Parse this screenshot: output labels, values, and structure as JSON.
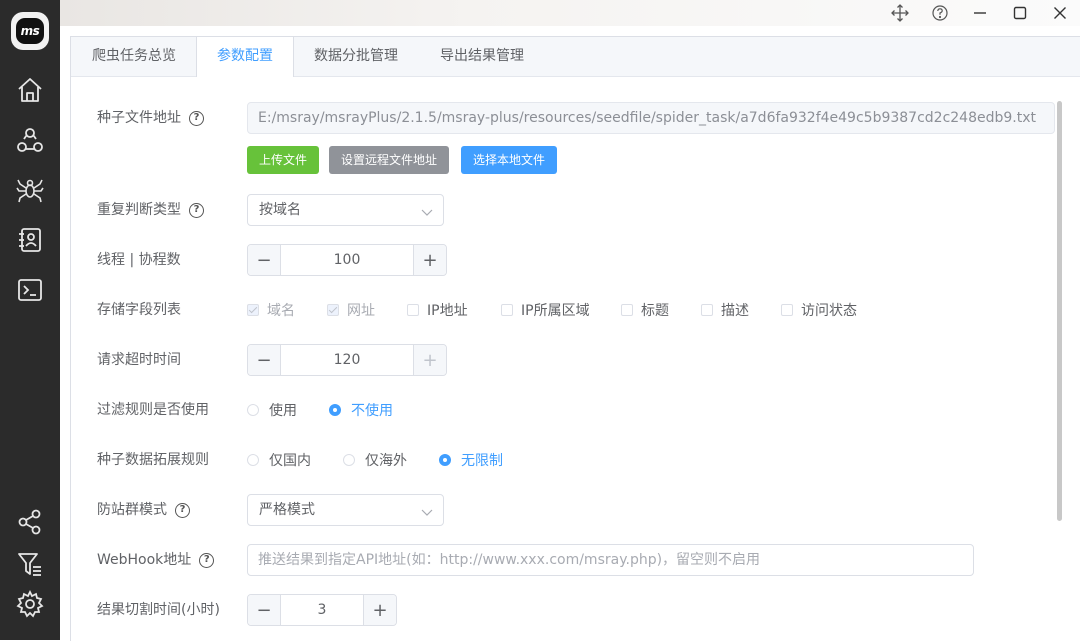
{
  "app": {
    "logo_text": "ms"
  },
  "colors": {
    "accent": "#409eff",
    "upload": "#67c23a",
    "remote": "#909399",
    "local": "#409eff"
  },
  "sidebar": {
    "items": [
      {
        "icon": "home-icon"
      },
      {
        "icon": "nodes-icon"
      },
      {
        "icon": "spider-icon"
      },
      {
        "icon": "contacts-icon"
      },
      {
        "icon": "terminal-icon"
      },
      {
        "icon": "share-icon"
      },
      {
        "icon": "filter-list-icon"
      },
      {
        "icon": "gear-icon"
      }
    ]
  },
  "window_controls": [
    "move-icon",
    "help-icon",
    "minimize-icon",
    "maximize-icon",
    "close-icon"
  ],
  "tabs": [
    {
      "label": "爬虫任务总览"
    },
    {
      "label": "参数配置"
    },
    {
      "label": "数据分批管理"
    },
    {
      "label": "导出结果管理"
    }
  ],
  "active_tab": "参数配置",
  "form": {
    "seed_file": {
      "label": "种子文件地址",
      "value": "E:/msray/msrayPlus/2.1.5/msray-plus/resources/seedfile/spider_task/a7d6fa932f4e49c5b9387cd2c248edb9.txt",
      "btn_upload": "上传文件",
      "btn_remote": "设置远程文件地址",
      "btn_local": "选择本地文件"
    },
    "dup_type": {
      "label": "重复判断类型",
      "value": "按域名"
    },
    "threads": {
      "label": "线程 | 协程数",
      "value": "100",
      "minus": "−",
      "plus": "+"
    },
    "fields": {
      "label": "存储字段列表",
      "options": [
        {
          "label": "域名",
          "checked": true
        },
        {
          "label": "网址",
          "checked": true
        },
        {
          "label": "IP地址",
          "checked": false
        },
        {
          "label": "IP所属区域",
          "checked": false
        },
        {
          "label": "标题",
          "checked": false
        },
        {
          "label": "描述",
          "checked": false
        },
        {
          "label": "访问状态",
          "checked": false
        }
      ]
    },
    "timeout": {
      "label": "请求超时时间",
      "value": "120",
      "minus": "−",
      "plus": "+"
    },
    "filter_rule": {
      "label": "过滤规则是否使用",
      "options": [
        {
          "label": "使用",
          "checked": false
        },
        {
          "label": "不使用",
          "checked": true
        }
      ]
    },
    "expand_rule": {
      "label": "种子数据拓展规则",
      "options": [
        {
          "label": "仅国内",
          "checked": false
        },
        {
          "label": "仅海外",
          "checked": false
        },
        {
          "label": "无限制",
          "checked": true
        }
      ]
    },
    "anti_station": {
      "label": "防站群模式",
      "value": "严格模式"
    },
    "webhook": {
      "label": "WebHook地址",
      "placeholder": "推送结果到指定API地址(如：http://www.xxx.com/msray.php)，留空则不启用"
    },
    "split_time": {
      "label": "结果切割时间(小时)",
      "value": "3",
      "minus": "−",
      "plus": "+"
    }
  }
}
